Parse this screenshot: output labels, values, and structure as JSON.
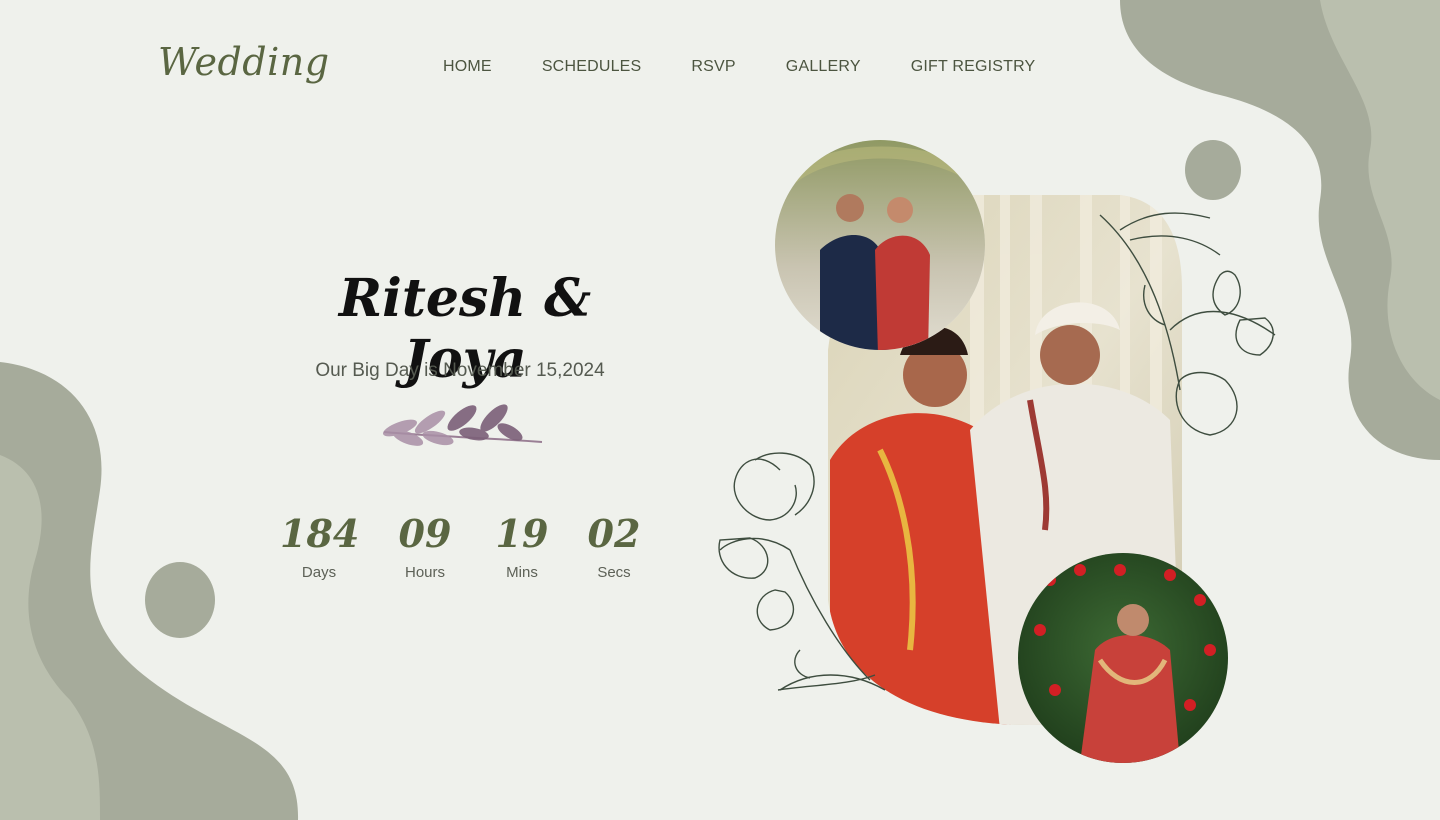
{
  "brand": {
    "logo": "Wedding"
  },
  "nav": {
    "items": [
      "HOME",
      "SCHEDULES",
      "RSVP",
      "GALLERY",
      "GIFT REGISTRY"
    ]
  },
  "hero": {
    "couple_names": "Ritesh & Joya",
    "subtitle": "Our Big Day is November 15,2024"
  },
  "countdown": [
    {
      "value": "184",
      "label": "Days"
    },
    {
      "value": "09",
      "label": "Hours"
    },
    {
      "value": "19",
      "label": "Mins"
    },
    {
      "value": "02",
      "label": "Secs"
    }
  ],
  "colors": {
    "background": "#eff1ec",
    "accent": "#5a6642",
    "blob_dark": "#a6ab9b",
    "blob_light": "#babfae"
  },
  "icons": [
    "leaf-sprig-icon",
    "floral-line-art-icon"
  ]
}
